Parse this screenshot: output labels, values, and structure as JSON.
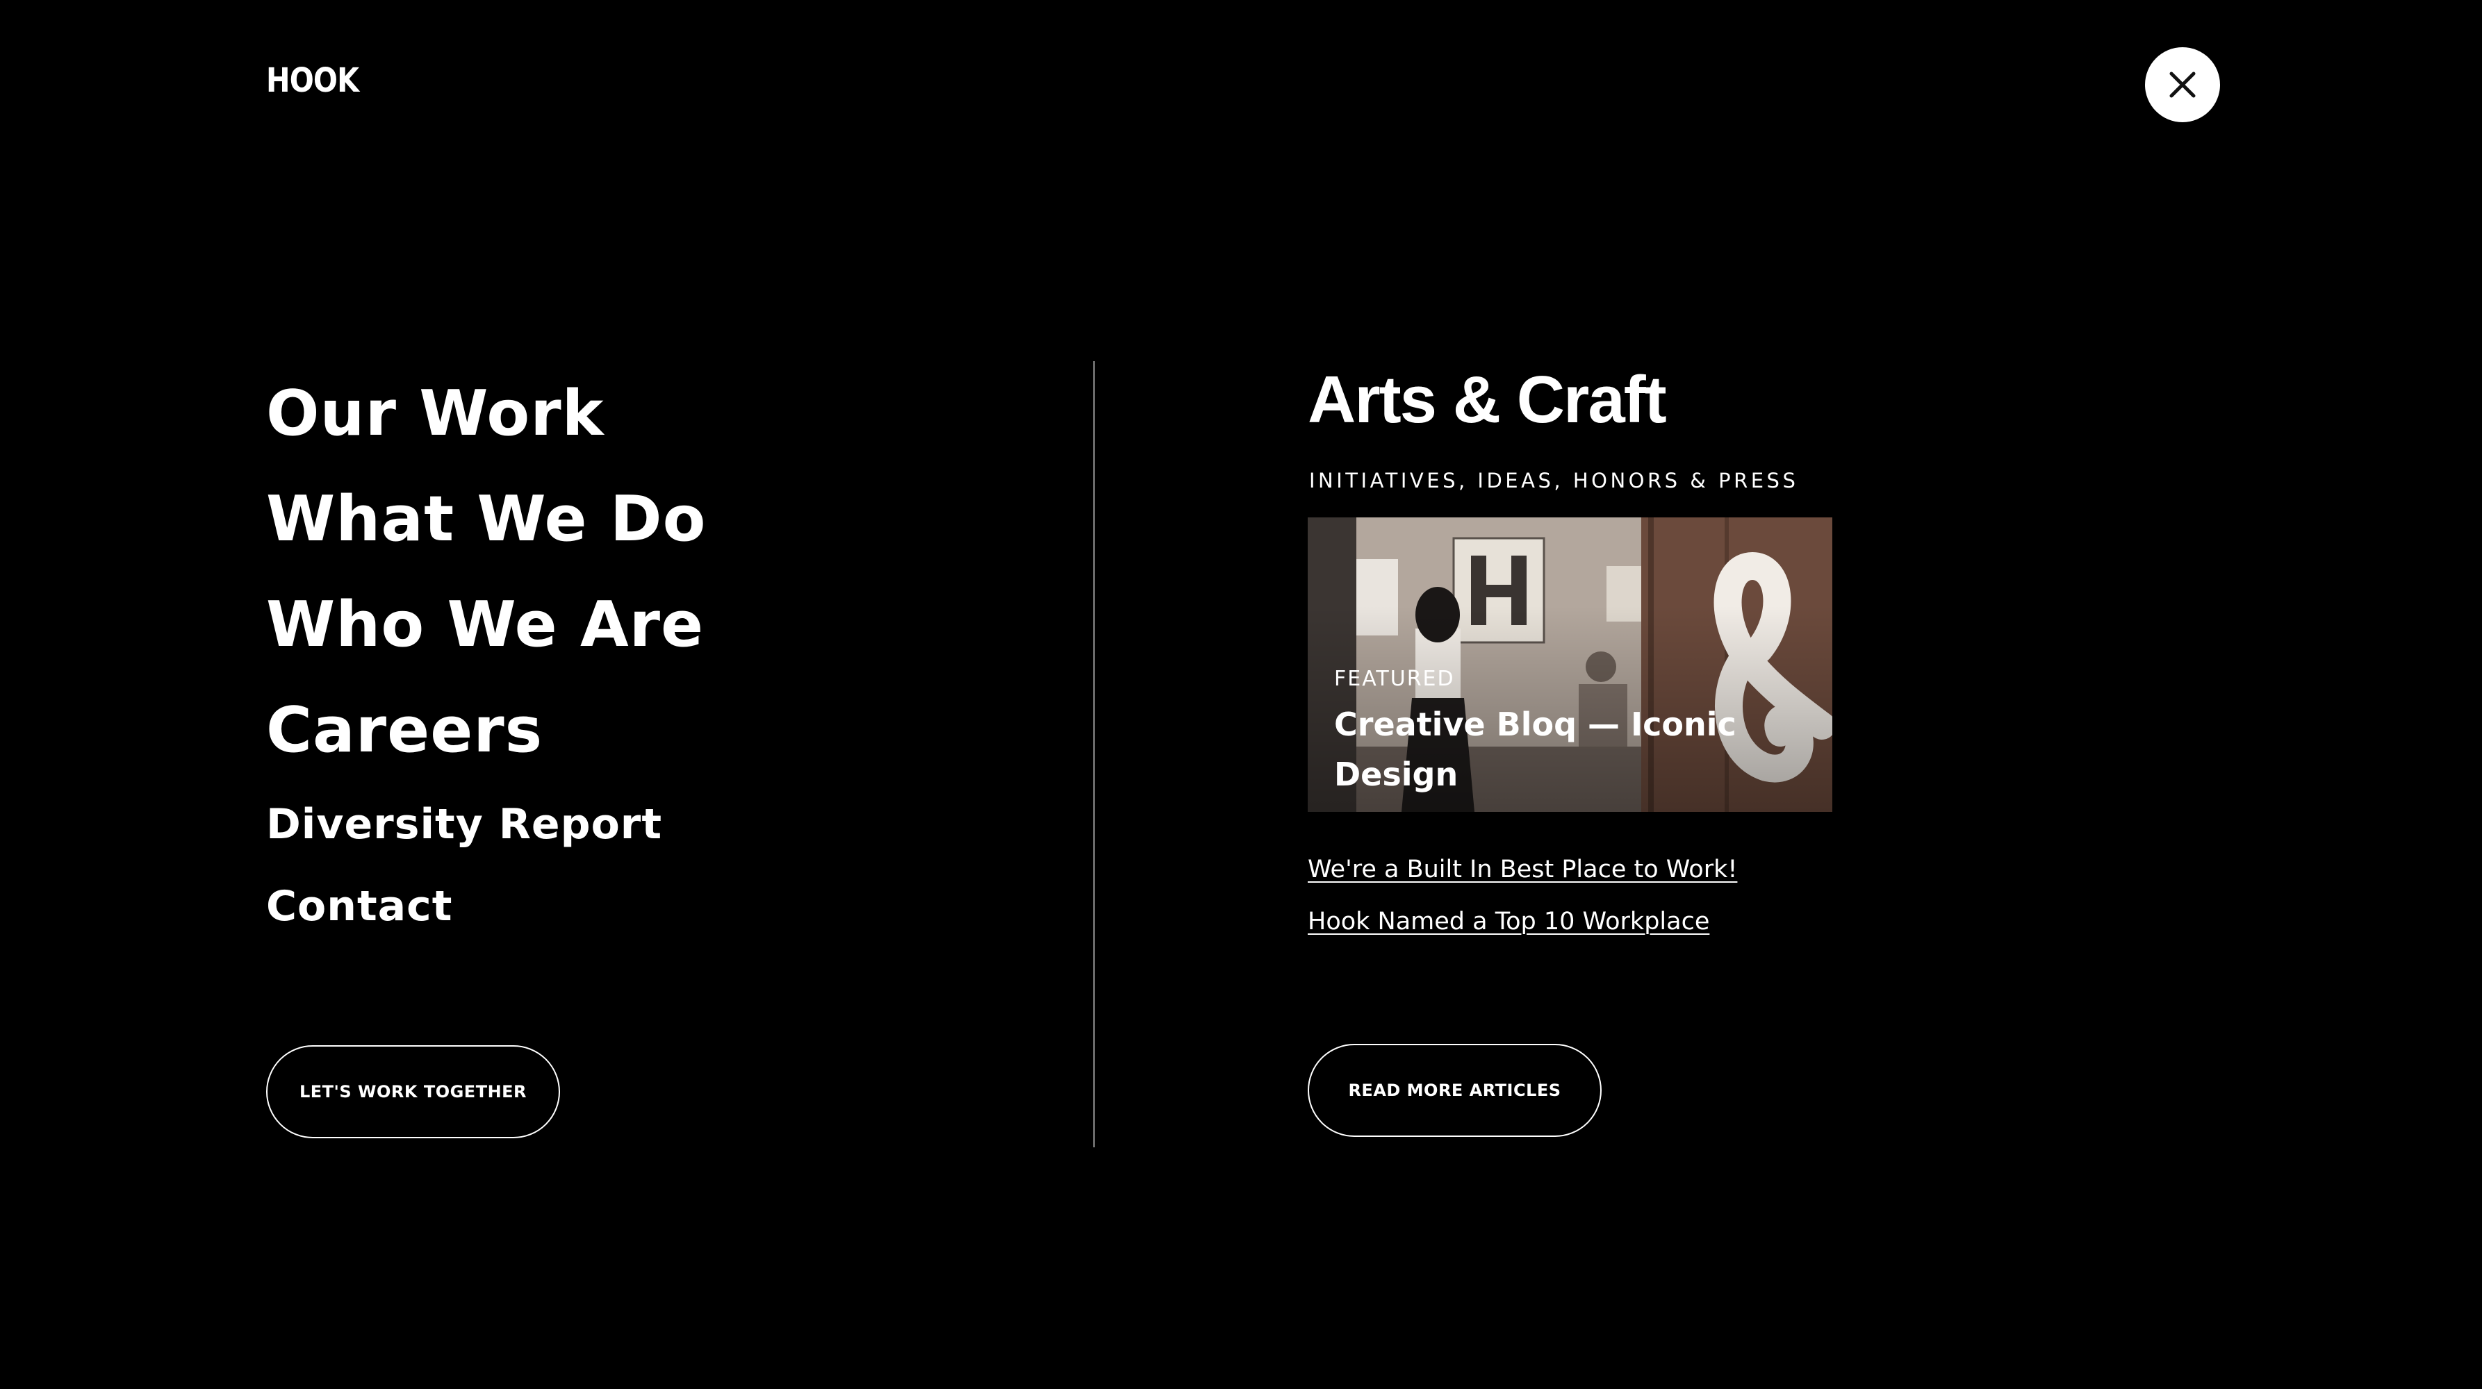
{
  "header": {
    "logo_text": "HOOK",
    "close_icon": "close-icon"
  },
  "main_nav": {
    "items": [
      {
        "label": "Our Work"
      },
      {
        "label": "What We Do"
      },
      {
        "label": "Who We Are"
      },
      {
        "label": "Careers"
      },
      {
        "label": "Diversity Report"
      },
      {
        "label": "Contact"
      }
    ],
    "cta_label": "LET'S WORK TOGETHER"
  },
  "arts_craft": {
    "title": "Arts & Craft",
    "subtitle": "INITIATIVES, IDEAS, HONORS & PRESS",
    "featured": {
      "label": "FEATURED",
      "title": "Creative Bloq — Iconic Design"
    },
    "links": [
      {
        "label": "We're a Built In Best Place to Work!"
      },
      {
        "label": "Hook Named a Top 10 Workplace"
      }
    ],
    "cta_label": "READ MORE ARTICLES"
  },
  "colors": {
    "background": "#000000",
    "text": "#ffffff",
    "divider": "#6b6b6b"
  }
}
